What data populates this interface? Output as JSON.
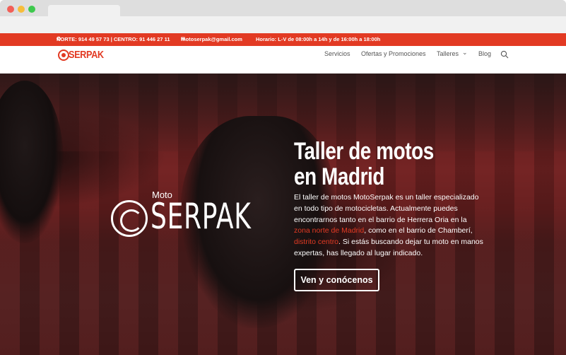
{
  "topbar": {
    "phones": "NORTE: 914 49 57 73 | CENTRO: 91 446 27 11",
    "email": "motoserpak@gmail.com",
    "hours": "Horario: L-V de 08:00h a 14h y de 16:00h a 18:00h",
    "phone_icon": "phone-icon",
    "email_icon": "envelope-icon"
  },
  "nav": {
    "logo_text": "SERPAK",
    "items": [
      "Servicios",
      "Ofertas y Promociones",
      "Talleres",
      "Blog"
    ],
    "search_icon": "search-icon"
  },
  "hero": {
    "logo_moto": "Moto",
    "logo_brand": "SERPAK",
    "title": "Taller de motos en Madrid",
    "text_1": "El taller de motos MotoSerpak es un taller especializado en todo tipo de motocicletas. Actualmente puedes encontrarnos tanto en el barrio de Herrera Oria en la ",
    "link_1": "zona norte de Madrid",
    "text_2": ", como en el barrio de Chamberí, ",
    "link_2": "distrito centro",
    "text_3": ". Si estás buscando dejar tu moto en manos expertas, has llegado al lugar indicado.",
    "cta": "Ven y conócenos"
  },
  "colors": {
    "accent": "#e23a23"
  }
}
